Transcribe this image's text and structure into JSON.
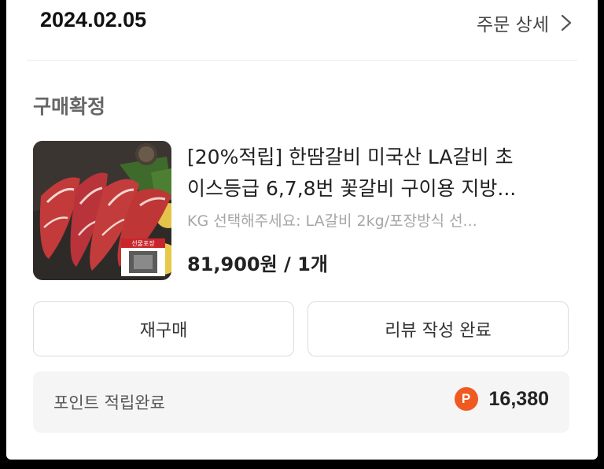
{
  "order": {
    "date": "2024.02.05",
    "detail_label": "주문 상세",
    "status": "구매확정"
  },
  "product": {
    "title_line1": "[20%적립] 한땀갈비 미국산 LA갈비 초",
    "title_line2": "이스등급 6,7,8번 꽃갈비 구이용 지방...",
    "option": "KG 선택해주세요: LA갈비 2kg/포장방식 선...",
    "price": "81,900원 / 1개",
    "thumb_badge": "선물포장"
  },
  "actions": {
    "rebuy_label": "재구매",
    "review_label": "리뷰 작성 완료"
  },
  "points": {
    "label": "포인트 적립완료",
    "badge": "P",
    "value": "16,380"
  },
  "colors": {
    "accent": "#f05a22",
    "status_text": "#666666",
    "option_text": "#a6a6a6"
  }
}
